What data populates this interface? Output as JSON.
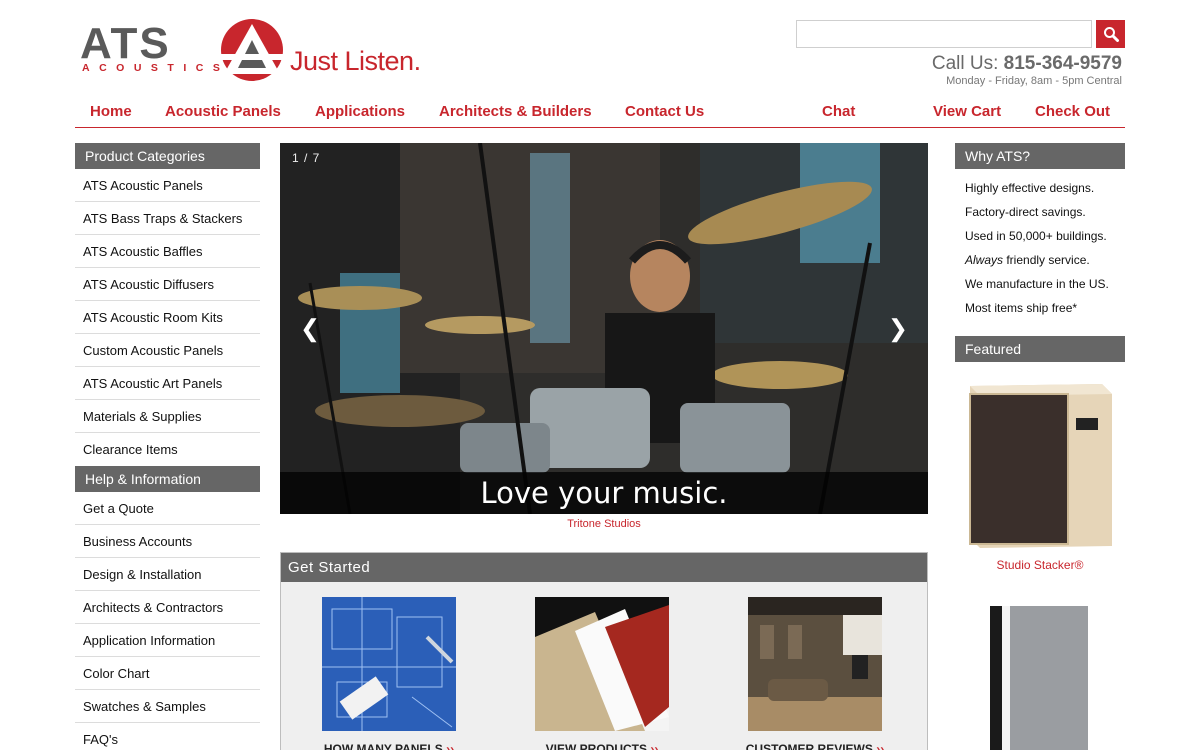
{
  "brand": {
    "logo_text": "ATS",
    "logo_subtext": "ACOUSTICS",
    "tagline": "Just Listen.",
    "accent_color": "#c8262d",
    "gray_color": "#666666"
  },
  "search": {
    "placeholder": "",
    "icon": "search-icon"
  },
  "contact": {
    "call_label": "Call Us:",
    "phone": "815-364-9579",
    "hours": "Monday - Friday, 8am - 5pm Central"
  },
  "nav": {
    "items": [
      {
        "label": "Home"
      },
      {
        "label": "Acoustic Panels"
      },
      {
        "label": "Applications"
      },
      {
        "label": "Architects & Builders"
      },
      {
        "label": "Contact Us"
      },
      {
        "label": "Chat"
      },
      {
        "label": "View Cart"
      },
      {
        "label": "Check Out"
      }
    ]
  },
  "sidebar": {
    "categories_title": "Product Categories",
    "categories": [
      "ATS Acoustic Panels",
      "ATS Bass Traps & Stackers",
      "ATS Acoustic Baffles",
      "ATS Acoustic Diffusers",
      "ATS Acoustic Room Kits",
      "Custom Acoustic Panels",
      "ATS Acoustic Art Panels",
      "Materials & Supplies",
      "Clearance Items"
    ],
    "help_title": "Help & Information",
    "help": [
      "Get a Quote",
      "Business Accounts",
      "Design & Installation",
      "Architects & Contractors",
      "Application Information",
      "Color Chart",
      "Swatches & Samples",
      "FAQ's"
    ]
  },
  "slider": {
    "counter": "1 / 7",
    "prev_icon": "❮",
    "next_icon": "❯",
    "caption": "Love your music.",
    "credit": "Tritone Studios"
  },
  "get_started": {
    "title": "Get Started",
    "tiles": [
      {
        "label": "HOW MANY PANELS",
        "arrow": "››"
      },
      {
        "label": "VIEW PRODUCTS",
        "arrow": "››"
      },
      {
        "label": "CUSTOMER REVIEWS",
        "arrow": "››"
      }
    ]
  },
  "why": {
    "title": "Why ATS?",
    "items": [
      {
        "em": "",
        "text": "Highly effective designs."
      },
      {
        "em": "",
        "text": "Factory-direct savings."
      },
      {
        "em": "",
        "text": "Used in 50,000+ buildings."
      },
      {
        "em": "Always",
        "text": " friendly service."
      },
      {
        "em": "",
        "text": "We manufacture in the US."
      },
      {
        "em": "",
        "text": "Most items ship free*"
      }
    ]
  },
  "featured": {
    "title": "Featured",
    "product_name": "Studio Stacker®"
  }
}
